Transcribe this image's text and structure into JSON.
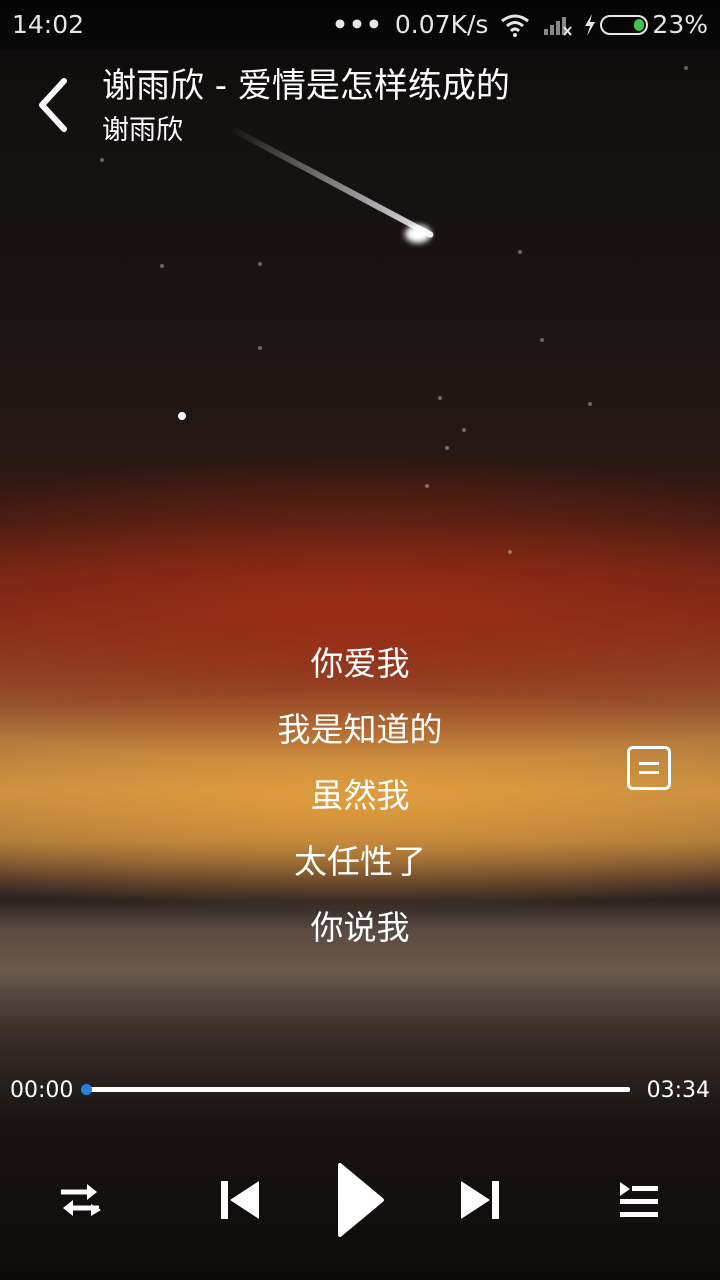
{
  "status_bar": {
    "time": "14:02",
    "network_speed": "0.07K/s",
    "battery": "23%",
    "icons": [
      "more-dots-icon",
      "wifi-icon",
      "signal-icon",
      "charging-icon",
      "battery-icon"
    ],
    "battery_level": 0.23,
    "battery_color": "#3ec34f"
  },
  "header": {
    "title": "谢雨欣 - 爱情是怎样练成的",
    "artist": "谢雨欣",
    "back_icon": "chevron-left-icon"
  },
  "lyrics": [
    "你爱我",
    "我是知道的",
    "虽然我",
    "太任性了",
    "你说我"
  ],
  "progress": {
    "current": "00:00",
    "total": "03:34",
    "fraction": 0,
    "accent": "#2a7de1"
  },
  "controls": {
    "icons": [
      "shuffle-icon",
      "previous-icon",
      "play-icon",
      "next-icon",
      "playlist-icon"
    ]
  }
}
